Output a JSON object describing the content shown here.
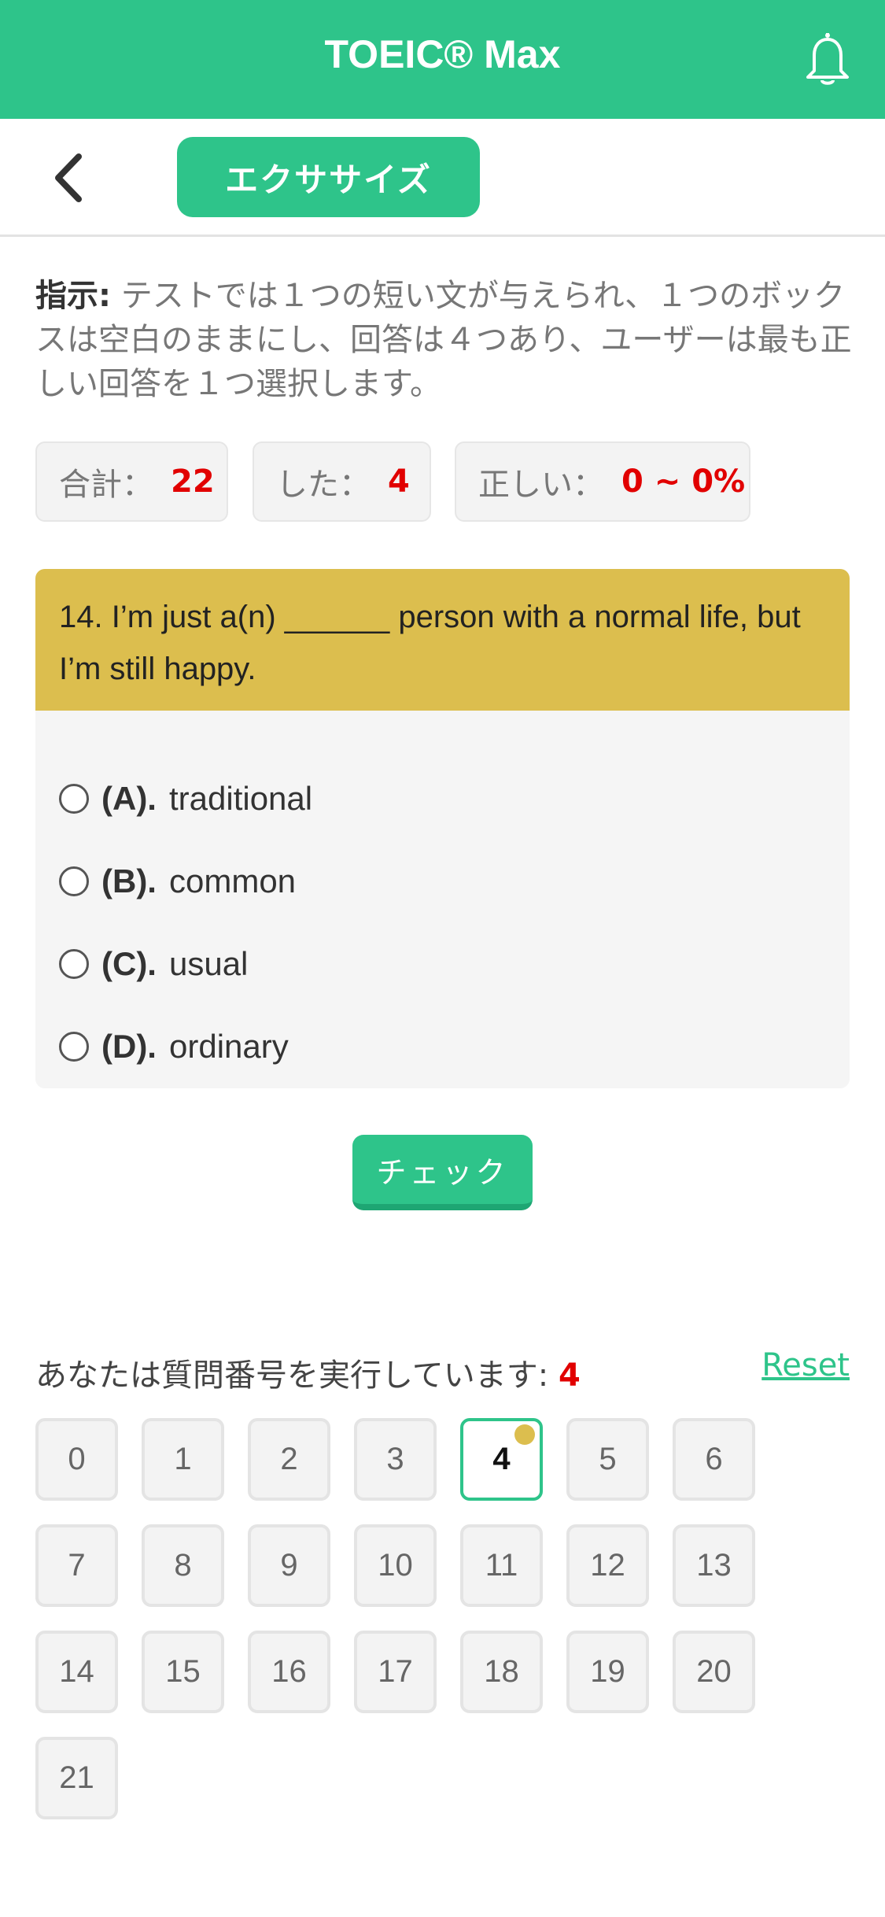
{
  "header": {
    "title": "TOEIC® Max",
    "bell_icon": "bell-icon",
    "color": "#2ec48a"
  },
  "subbar": {
    "back_icon": "chevron-left-icon",
    "tab_label": "エクササイズ"
  },
  "instructions": {
    "prefix": "指示:",
    "text": " テストでは１つの短い文が与えられ、１つのボックスは空白のままにし、回答は４つあり、ユーザーは最も正しい回答を１つ選択します。"
  },
  "stats": [
    {
      "label": "合計：",
      "value": "22"
    },
    {
      "label": "した：",
      "value": "4"
    },
    {
      "label": "正しい：",
      "value": "0 ~ 0%"
    }
  ],
  "question": {
    "text": "14. I’m just a(n) ______ person with a normal life, but I’m still happy.",
    "options": [
      {
        "label": "(A).",
        "text": "traditional"
      },
      {
        "label": "(B).",
        "text": "common"
      },
      {
        "label": "(C).",
        "text": "usual"
      },
      {
        "label": "(D).",
        "text": "ordinary"
      }
    ]
  },
  "check_label": "チェック",
  "progress": {
    "text": "あなたは質問番号を実行しています:",
    "current": "4",
    "reset_label": "Reset"
  },
  "numbers": [
    "0",
    "1",
    "2",
    "3",
    "4",
    "5",
    "6",
    "7",
    "8",
    "9",
    "10",
    "11",
    "12",
    "13",
    "14",
    "15",
    "16",
    "17",
    "18",
    "19",
    "20",
    "21"
  ],
  "active_number": "4",
  "accent_yellow": "#dcbe4e"
}
